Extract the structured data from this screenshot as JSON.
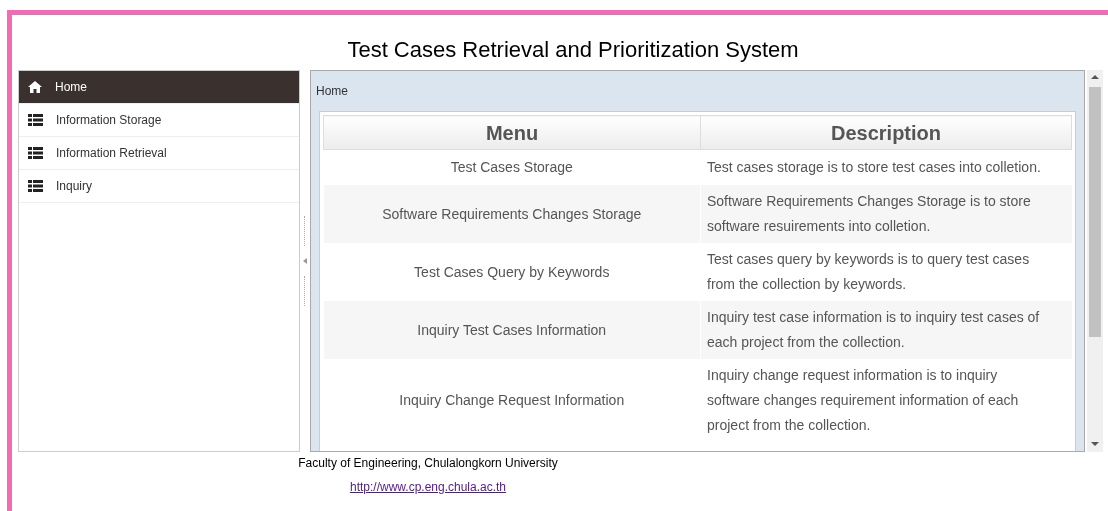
{
  "title": "Test Cases Retrieval and Prioritization System",
  "sidebar": {
    "items": [
      {
        "label": "Home",
        "kind": "home",
        "selected": true
      },
      {
        "label": "Information Storage",
        "kind": "list",
        "selected": false
      },
      {
        "label": "Information Retrieval",
        "kind": "list",
        "selected": false
      },
      {
        "label": "Inquiry",
        "kind": "list",
        "selected": false
      }
    ]
  },
  "breadcrumb": "Home",
  "table": {
    "columns": [
      "Menu",
      "Description"
    ],
    "rows": [
      {
        "menu": "Test Cases Storage",
        "description": "Test cases storage is to store test cases into colletion."
      },
      {
        "menu": "Software Requirements Changes Storage",
        "description": "Software Requirements Changes Storage is to store software resuirements into colletion."
      },
      {
        "menu": "Test Cases Query by Keywords",
        "description": "Test cases query by keywords is to query test cases from the collection by keywords."
      },
      {
        "menu": "Inquiry Test Cases Information",
        "description": "Inquiry test case information is to inquiry test cases of each project from the collection."
      },
      {
        "menu": "Inquiry Change Request Information",
        "description": "Inquiry change request information is to inquiry software changes requirement information of each project from the collection."
      }
    ]
  },
  "footer": {
    "text": "Faculty of Engineering, Chulalongkorn University",
    "link": "http://www.cp.eng.chula.ac.th"
  }
}
